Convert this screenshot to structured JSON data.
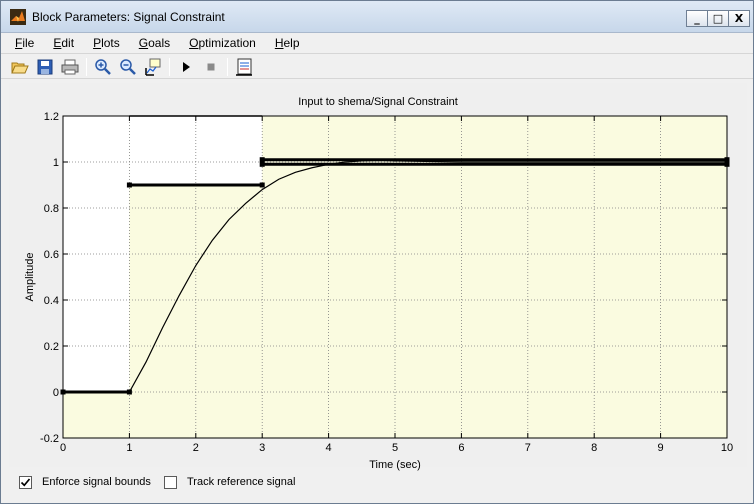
{
  "window": {
    "title": "Block Parameters: Signal Constraint",
    "controls": {
      "minimize": "_",
      "maximize": "□",
      "close": "X"
    }
  },
  "menu": [
    {
      "label": "File",
      "accel": "F",
      "rest": "ile"
    },
    {
      "label": "Edit",
      "accel": "E",
      "rest": "dit"
    },
    {
      "label": "Plots",
      "accel": "P",
      "rest": "lots"
    },
    {
      "label": "Goals",
      "accel": "G",
      "rest": "oals"
    },
    {
      "label": "Optimization",
      "accel": "O",
      "rest": "ptimization"
    },
    {
      "label": "Help",
      "accel": "H",
      "rest": "elp"
    }
  ],
  "toolbar": {
    "icons": [
      "open-icon",
      "save-icon",
      "print-icon",
      "zoom-in-icon",
      "zoom-out-icon",
      "data-cursor-icon",
      "play-icon",
      "stop-icon",
      "response-plot-icon"
    ]
  },
  "chart_data": {
    "type": "line",
    "title": "Input to shema/Signal Constraint",
    "xlabel": "Time (sec)",
    "ylabel": "Amplitude",
    "xlim": [
      0,
      10
    ],
    "ylim": [
      -0.2,
      1.2
    ],
    "xticks": [
      "0",
      "1",
      "2",
      "3",
      "4",
      "5",
      "6",
      "7",
      "8",
      "9",
      "10"
    ],
    "yticks": [
      "-0.2",
      "0",
      "0.2",
      "0.4",
      "0.6",
      "0.8",
      "1",
      "1.2"
    ],
    "grid": true,
    "colors": {
      "plot_bg": "#fafbe0",
      "infeasible_bg": "#ffffff",
      "signal": "#000000",
      "bounds": "#000000",
      "grid": "#7f7f7f"
    },
    "bounds": {
      "upper": [
        {
          "x": [
            0,
            1
          ],
          "y": [
            0,
            0
          ]
        },
        {
          "x": [
            1,
            3
          ],
          "y": [
            1.2,
            1.2
          ]
        },
        {
          "x": [
            3,
            10
          ],
          "y": [
            1.01,
            1.01
          ]
        }
      ],
      "lower": [
        {
          "x": [
            1,
            3
          ],
          "y": [
            0.9,
            0.9
          ]
        },
        {
          "x": [
            3,
            10
          ],
          "y": [
            0.99,
            0.99
          ]
        }
      ]
    },
    "signal": {
      "x": [
        0,
        1,
        1.25,
        1.5,
        1.75,
        2,
        2.25,
        2.5,
        2.75,
        3,
        3.25,
        3.5,
        3.75,
        4,
        4.25,
        4.5,
        4.75,
        5,
        6,
        7,
        8,
        9,
        10
      ],
      "y": [
        0,
        0,
        0.13,
        0.28,
        0.42,
        0.55,
        0.66,
        0.75,
        0.82,
        0.88,
        0.925,
        0.955,
        0.975,
        0.99,
        1.0,
        1.005,
        1.007,
        1.005,
        1.0,
        1.0,
        1.0,
        1.0,
        1.0
      ]
    }
  },
  "options": {
    "enforce_bounds": {
      "label": "Enforce signal bounds",
      "checked": true
    },
    "track_reference": {
      "label": "Track reference signal",
      "checked": false
    }
  }
}
